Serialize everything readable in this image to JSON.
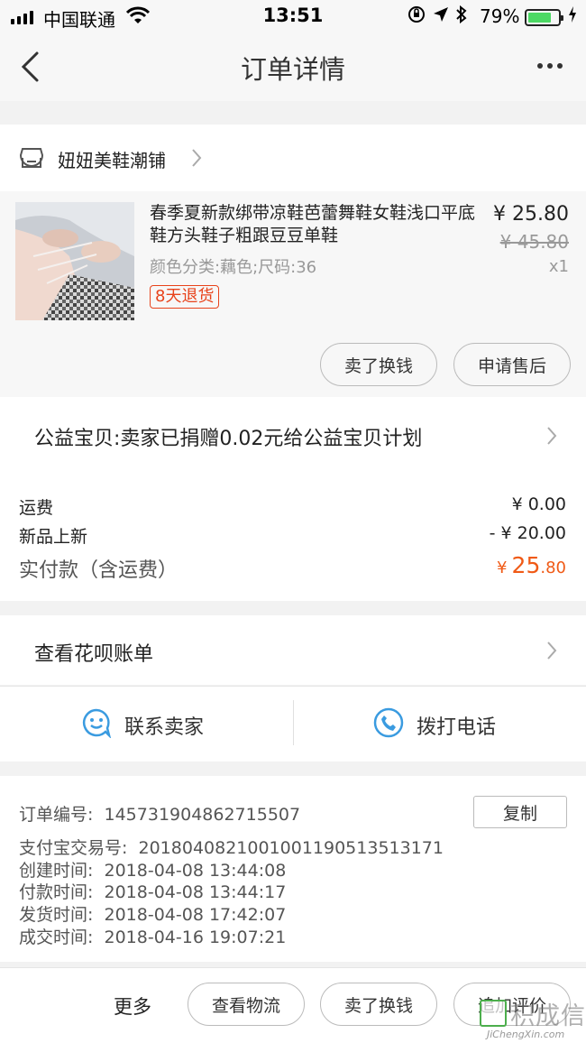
{
  "status_bar": {
    "carrier": "中国联通",
    "time": "13:51",
    "battery_percent": "79%",
    "battery_level": 0.79
  },
  "nav": {
    "title": "订单详情"
  },
  "store": {
    "name": "妞妞美鞋潮铺"
  },
  "item": {
    "title": "春季夏新款绑带凉鞋芭蕾舞鞋女鞋浅口平底鞋方头鞋子粗跟豆豆单鞋",
    "spec": "颜色分类:藕色;尺码:36",
    "badge": "8天退货",
    "price": "¥ 25.80",
    "original_price": "¥ 45.80",
    "quantity": "x1",
    "buttons": {
      "sell": "卖了换钱",
      "after_sale": "申请售后"
    }
  },
  "charity": {
    "text": "公益宝贝:卖家已捐赠0.02元给公益宝贝计划"
  },
  "fees": {
    "shipping_label": "运费",
    "shipping_value": "¥ 0.00",
    "discount_label": "新品上新",
    "discount_value": "- ¥ 20.00",
    "paid_label": "实付款（含运费）",
    "paid_currency": "¥",
    "paid_integer": "25",
    "paid_decimal": ".80"
  },
  "huabei": {
    "text": "查看花呗账单"
  },
  "contact": {
    "seller": "联系卖家",
    "call": "拨打电话"
  },
  "order_info": {
    "copy_label": "复制",
    "order_no_label": "订单编号:",
    "order_no": "145731904862715507",
    "alipay_label": "支付宝交易号:",
    "alipay_no": "2018040821001001190513513171",
    "created_label": "创建时间:",
    "created": "2018-04-08 13:44:08",
    "paid_label": "付款时间:",
    "paid": "2018-04-08 13:44:17",
    "shipped_label": "发货时间:",
    "shipped": "2018-04-08 17:42:07",
    "completed_label": "成交时间:",
    "completed": "2018-04-16 19:07:21"
  },
  "bottom": {
    "more": "更多",
    "logistics": "查看物流",
    "sell": "卖了换钱",
    "review": "追加评价"
  },
  "watermark": {
    "text": "积成信",
    "sub": "JiChengXin.com"
  },
  "colors": {
    "accent_orange": "#f05a16",
    "badge_red": "#e8431b",
    "icon_blue": "#3a9be0"
  }
}
